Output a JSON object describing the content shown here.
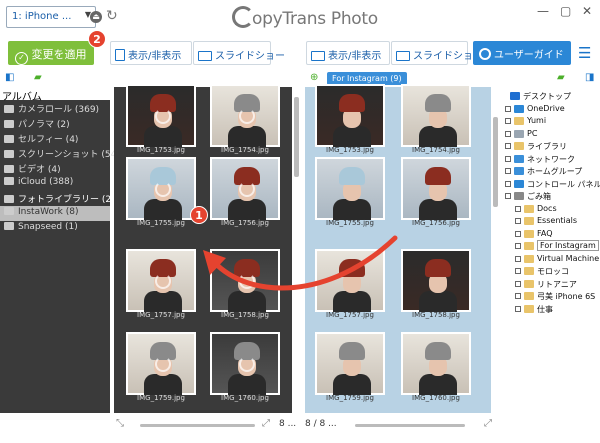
{
  "window": {
    "app_title": "CopyTrans Photo",
    "app_title_rest": "opyTrans Photo"
  },
  "device": {
    "label": "1: iPhone ..."
  },
  "toolbar": {
    "apply_label": "変更を適用",
    "left_toggle_label": "表示/非表示",
    "left_slideshow_label": "スライドショー",
    "right_toggle_label": "表示/非表示",
    "right_slideshow_label": "スライドショー",
    "guide_label": "ユーザーガイド"
  },
  "albums": {
    "header": "アルバム",
    "items": [
      {
        "label": "カメラロール (369)"
      },
      {
        "label": "パノラマ (2)"
      },
      {
        "label": "セルフィー (4)"
      },
      {
        "label": "スクリーンショット (54)"
      },
      {
        "label": "ビデオ (4)"
      },
      {
        "label": "iCloud (388)"
      },
      {
        "label": "フォトライブラリー (26)"
      },
      {
        "label": "InstaWork (8)"
      },
      {
        "label": "Snapseed (1)"
      }
    ]
  },
  "left_grid": {
    "photos": [
      {
        "name": "IMG_1753.jpg"
      },
      {
        "name": "IMG_1754.jpg"
      },
      {
        "name": "IMG_1755.jpg"
      },
      {
        "name": "IMG_1756.jpg"
      },
      {
        "name": "IMG_1757.jpg"
      },
      {
        "name": "IMG_1758.jpg"
      },
      {
        "name": "IMG_1759.jpg"
      },
      {
        "name": "IMG_1760.jpg"
      }
    ],
    "pager": "8 ..."
  },
  "right_grid": {
    "tag": "For Instagram (9)",
    "photos": [
      {
        "name": "IMG_1753.jpg"
      },
      {
        "name": "IMG_1754.jpg"
      },
      {
        "name": "IMG_1755.jpg"
      },
      {
        "name": "IMG_1756.jpg"
      },
      {
        "name": "IMG_1757.jpg"
      },
      {
        "name": "IMG_1758.jpg"
      },
      {
        "name": "IMG_1759.jpg"
      },
      {
        "name": "IMG_1760.jpg"
      }
    ],
    "pager": "8 / 8 ..."
  },
  "tree": {
    "items": [
      {
        "label": "デスクトップ"
      },
      {
        "label": "OneDrive"
      },
      {
        "label": "Yumi"
      },
      {
        "label": "PC"
      },
      {
        "label": "ライブラリ"
      },
      {
        "label": "ネットワーク"
      },
      {
        "label": "ホームグループ"
      },
      {
        "label": "コントロール パネル"
      },
      {
        "label": "ごみ箱"
      },
      {
        "label": "Docs"
      },
      {
        "label": "Essentials"
      },
      {
        "label": "FAQ"
      },
      {
        "label": "For Instagram"
      },
      {
        "label": "Virtual Machine"
      },
      {
        "label": "モロッコ"
      },
      {
        "label": "リトアニア"
      },
      {
        "label": "弓美 iPhone 6S"
      },
      {
        "label": "仕事"
      }
    ]
  },
  "annotations": {
    "step1": "1",
    "step2": "2"
  },
  "colors": {
    "apply": "#7fbf3b",
    "guide": "#2b87d6",
    "accent": "#1a74c9",
    "badge": "#e5432f",
    "arrow": "#e5432f"
  }
}
